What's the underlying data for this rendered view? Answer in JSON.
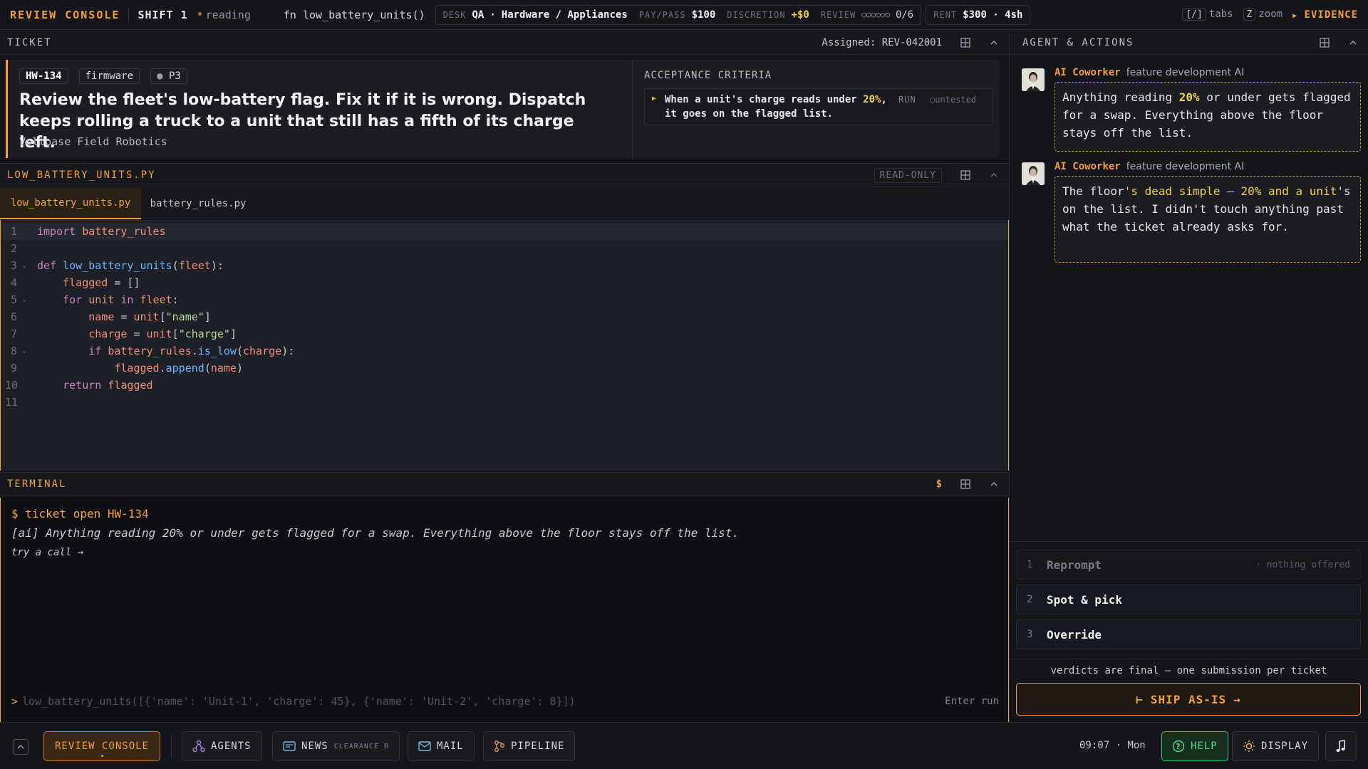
{
  "topbar": {
    "brand": "REVIEW CONSOLE",
    "shift": "SHIFT 1",
    "status": "reading",
    "fn_prefix": "fn",
    "fn_name": "low_battery_units()",
    "desk_label": "DESK",
    "desk_value": "QA",
    "desk_dot": "·",
    "desk_category": "Hardware / Appliances",
    "paypass_label": "PAY/PASS",
    "paypass_value": "$100",
    "discretion_label": "DISCRETION",
    "discretion_value": "+$0",
    "review_label": "REVIEW",
    "review_dots": "○○○○○○",
    "review_count": "0/6",
    "rent_label": "RENT",
    "rent_value": "$300 · 4sh",
    "tabs_key": "[/]",
    "tabs_label": "tabs",
    "zoom_key": "Z",
    "zoom_label": "zoom",
    "evidence_label": "EVIDENCE"
  },
  "ticket": {
    "header": "TICKET",
    "assigned": "Assigned: REV-042001",
    "id": "HW-134",
    "component": "firmware",
    "priority": "P3",
    "title": "Review the fleet's low-battery flag. Fix it if it is wrong. Dispatch keeps rolling a truck to a unit that still has a fifth of its charge left.",
    "company": "Voltbase Field Robotics",
    "acceptance_header": "ACCEPTANCE CRITERIA",
    "criteria": {
      "text_before": "When a unit's charge reads under",
      "highlight": "20%",
      "text_after": ", it goes on the flagged list.",
      "run_label": "RUN",
      "status": "untested"
    }
  },
  "editor": {
    "header": "LOW_BATTERY_UNITS.PY",
    "readonly": "READ-ONLY",
    "tabs": [
      "low_battery_units.py",
      "battery_rules.py"
    ],
    "active_tab": 0,
    "line_numbers": [
      "1",
      "2",
      "3",
      "4",
      "5",
      "6",
      "7",
      "8",
      "9",
      "10",
      "11"
    ]
  },
  "terminal": {
    "header": "TERMINAL",
    "prompt_icon": "$",
    "lines": [
      "$ ticket open HW-134",
      "[ai] Anything reading 20% or under gets flagged for a swap. Everything above the floor stays off the list.",
      "try a call →"
    ],
    "input_prefix": ">",
    "input_placeholder": "low_battery_units([{'name': 'Unit-1', 'charge': 45}, {'name': 'Unit-2', 'charge': 8}])",
    "enter_hint": "Enter run"
  },
  "agent": {
    "header": "AGENT & ACTIONS",
    "messages": [
      {
        "name": "AI Coworker",
        "role": "feature development AI"
      },
      {
        "name": "AI Coworker",
        "role": "feature development AI"
      }
    ],
    "actions": [
      {
        "num": "1",
        "label": "Reprompt",
        "note": "· nothing offered"
      },
      {
        "num": "2",
        "label": "Spot & pick",
        "note": ""
      },
      {
        "num": "3",
        "label": "Override",
        "note": ""
      }
    ],
    "verdict_note": "verdicts are final — one submission per ticket",
    "ship_label": "SHIP AS-IS"
  },
  "bottombar": {
    "review_console": "REVIEW CONSOLE",
    "agents": "AGENTS",
    "news": "NEWS",
    "clearance": "CLEARANCE B",
    "mail": "MAIL",
    "pipeline": "PIPELINE",
    "time": "09:07 · Mon",
    "help": "HELP",
    "display": "DISPLAY"
  },
  "colors": {
    "accent": "#f0a040",
    "highlight": "#f2d24a",
    "background": "#13151b",
    "help_green": "#3fbf6a"
  },
  "icons": [
    "grid-icon",
    "chevron-up-icon",
    "agents-icon",
    "news-icon",
    "mail-icon",
    "pipeline-icon",
    "help-icon",
    "display-icon",
    "music-icon",
    "home-icon"
  ]
}
